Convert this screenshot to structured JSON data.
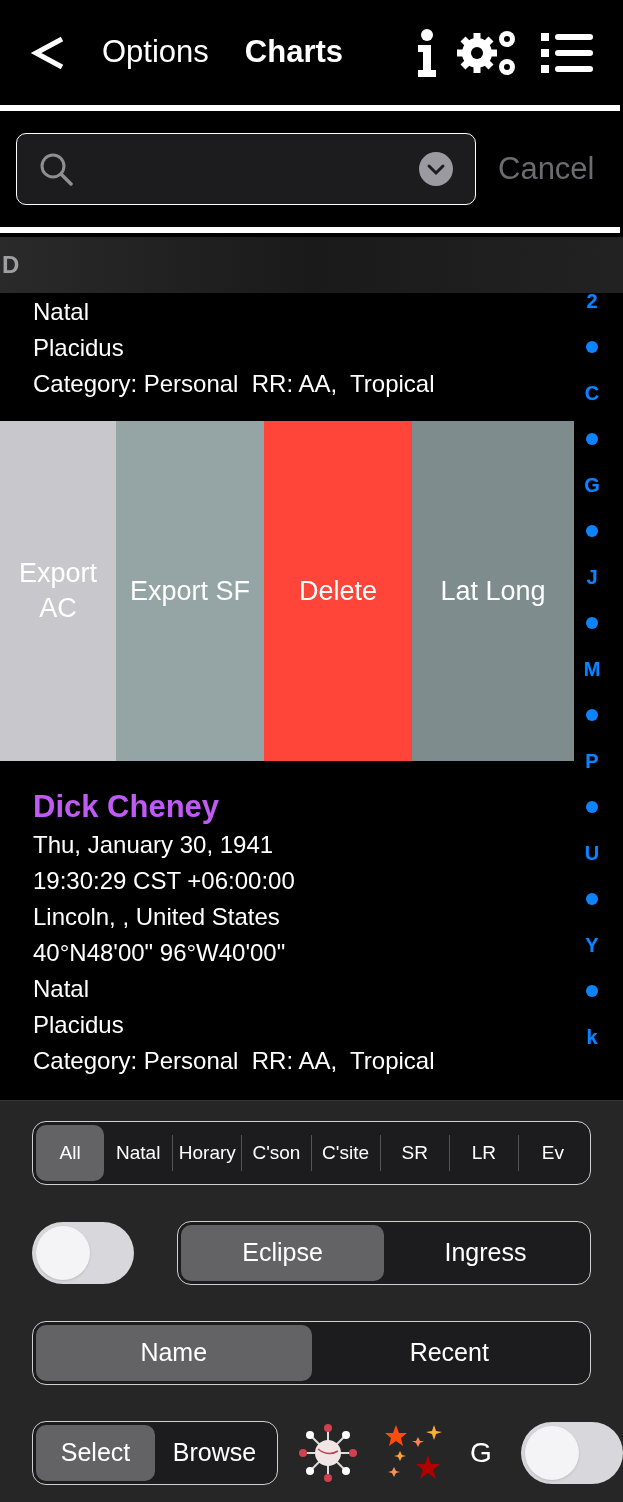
{
  "nav": {
    "options": "Options",
    "title": "Charts"
  },
  "search": {
    "cancel": "Cancel"
  },
  "section": "D",
  "rows": [
    {
      "lines": [
        "Natal",
        "Placidus",
        "Category: Personal  RR: AA,  Tropical"
      ]
    },
    {
      "name": "Dick Cheney",
      "lines": [
        "Thu, January 30, 1941",
        "19:30:29 CST +06:00:00",
        "Lincoln, , United States",
        "40°N48'00\" 96°W40'00\"",
        "Natal",
        "Placidus",
        "Category: Personal  RR: AA,  Tropical"
      ]
    }
  ],
  "swipe_actions": [
    {
      "label": "Export AC",
      "color": "#c7c7cc"
    },
    {
      "label": "Export SF",
      "color": "#95a5a6"
    },
    {
      "label": "Delete",
      "color": "#ff453a"
    },
    {
      "label": "Lat Long",
      "color": "#7f8c8d"
    }
  ],
  "index": [
    {
      "kind": "letter",
      "text": "2"
    },
    {
      "kind": "dot"
    },
    {
      "kind": "letter",
      "text": "C"
    },
    {
      "kind": "dot"
    },
    {
      "kind": "letter",
      "text": "G"
    },
    {
      "kind": "dot"
    },
    {
      "kind": "letter",
      "text": "J"
    },
    {
      "kind": "dot"
    },
    {
      "kind": "letter",
      "text": "M"
    },
    {
      "kind": "dot"
    },
    {
      "kind": "letter",
      "text": "P"
    },
    {
      "kind": "dot"
    },
    {
      "kind": "letter",
      "text": "U"
    },
    {
      "kind": "dot"
    },
    {
      "kind": "letter",
      "text": "Y"
    },
    {
      "kind": "dot"
    },
    {
      "kind": "letter",
      "text": "k"
    }
  ],
  "filter_tabs": [
    {
      "label": "All",
      "selected": true
    },
    {
      "label": "Natal",
      "selected": false
    },
    {
      "label": "Horary",
      "selected": false
    },
    {
      "label": "C'son",
      "selected": false
    },
    {
      "label": "C'site",
      "selected": false
    },
    {
      "label": "SR",
      "selected": false
    },
    {
      "label": "LR",
      "selected": false
    },
    {
      "label": "Ev",
      "selected": false
    }
  ],
  "eclipse_toggle": {
    "on": false
  },
  "event_segments": [
    {
      "label": "Eclipse",
      "selected": true
    },
    {
      "label": "Ingress",
      "selected": false
    }
  ],
  "sort_segments": [
    {
      "label": "Name",
      "selected": true
    },
    {
      "label": "Recent",
      "selected": false
    }
  ],
  "mode_segments": [
    {
      "label": "Select",
      "selected": true
    },
    {
      "label": "Browse",
      "selected": false
    }
  ],
  "g_label": "G",
  "g_toggle": {
    "on": false
  }
}
